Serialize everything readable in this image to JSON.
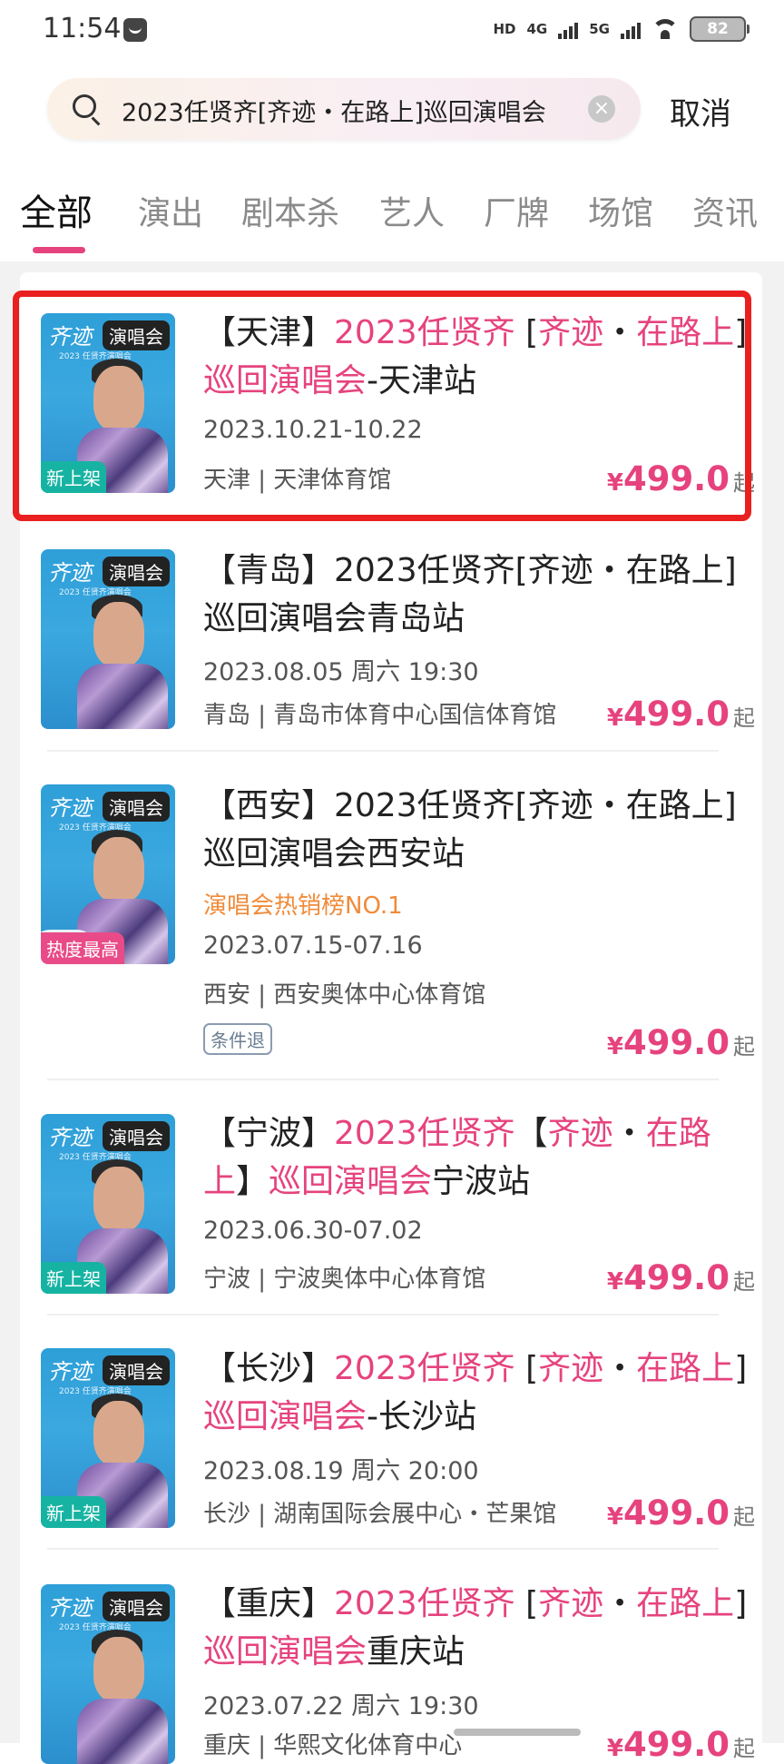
{
  "status": {
    "time": "11:54",
    "network": "HD",
    "net1": "4G",
    "net2": "5G",
    "battery": "82"
  },
  "search": {
    "query": "2023任贤齐[齐迹・在路上]巡回演唱会",
    "clear": "×",
    "cancel": "取消"
  },
  "tabs": [
    {
      "label": "全部"
    },
    {
      "label": "演出"
    },
    {
      "label": "剧本杀"
    },
    {
      "label": "艺人"
    },
    {
      "label": "厂牌"
    },
    {
      "label": "场馆"
    },
    {
      "label": "资讯"
    }
  ],
  "poster": {
    "brand": "齐迹",
    "brand_sub": "2023 任贤齐演唱会",
    "type_badge": "演唱会"
  },
  "results": [
    {
      "title": [
        "【天津】",
        "2023任贤齐",
        " [",
        "齐迹",
        "・",
        "在路上",
        "]",
        "巡回演唱会",
        "-天津站"
      ],
      "date": "2023.10.21-10.22",
      "venue": "天津 | 天津体育馆",
      "corner": "新上架",
      "price": "499.0",
      "yen": "¥",
      "qi": "起"
    },
    {
      "title": "【青岛】2023任贤齐[齐迹・在路上]巡回演唱会青岛站",
      "date": "2023.08.05 周六 19:30",
      "venue": "青岛 | 青岛市体育中心国信体育馆",
      "price": "499.0",
      "yen": "¥",
      "qi": "起"
    },
    {
      "title": "【西安】2023任贤齐[齐迹・在路上]巡回演唱会西安站",
      "hot": "演唱会热销榜NO.1",
      "date": "2023.07.15-07.16",
      "venue": "西安 | 西安奥体中心体育馆",
      "refund": "条件退",
      "corner": "热度最高",
      "price": "499.0",
      "yen": "¥",
      "qi": "起"
    },
    {
      "title": [
        "【宁波】",
        "2023任贤齐",
        "【",
        "齐迹",
        "・",
        "在路上",
        "】",
        "巡回演唱会",
        "宁波站"
      ],
      "date": "2023.06.30-07.02",
      "venue": "宁波 | 宁波奥体中心体育馆",
      "corner": "新上架",
      "price": "499.0",
      "yen": "¥",
      "qi": "起"
    },
    {
      "title": [
        "【长沙】",
        "2023任贤齐",
        " [",
        "齐迹",
        "・",
        "在路上",
        "]",
        "巡回演唱会",
        "-长沙站"
      ],
      "date": "2023.08.19 周六 20:00",
      "venue": "长沙 | 湖南国际会展中心・芒果馆",
      "corner": "新上架",
      "price": "499.0",
      "yen": "¥",
      "qi": "起"
    },
    {
      "title": [
        "【重庆】",
        "2023任贤齐",
        " [",
        "齐迹",
        "・",
        "在路上",
        "]",
        "巡回演唱会",
        "重庆站"
      ],
      "date": "2023.07.22 周六 19:30",
      "venue": "重庆 | 华熙文化体育中心",
      "price": "499.0",
      "yen": "¥",
      "qi": "起"
    }
  ]
}
